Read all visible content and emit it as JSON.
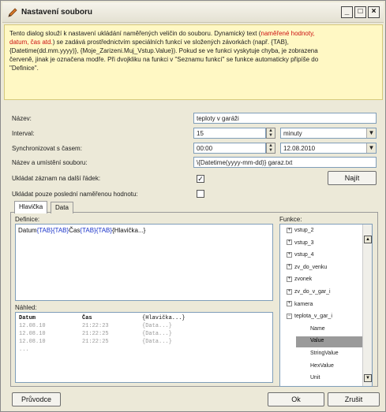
{
  "window": {
    "title": "Nastavení souboru",
    "controls": [
      "_",
      "□",
      "×"
    ]
  },
  "info": {
    "line1": "Tento dialog slouží k nastavení ukládání naměřených veličin do souboru. Dynamický text (",
    "red1": "naměřené hodnoty,",
    "line2_red": "datum, čas atd.",
    "line2": ") se zadává prostřednictvím speciálních funkcí ve složených závorkách (např. {TAB},",
    "line3": "{Datetime(dd.mm.yyyy)}, {Moje_Zarizeni.Muj_Vstup.Value}). Pokud se ve funkci vyskytuje chyba, je zobrazena",
    "line4": "červeně, jinak je označena modře. Při dvojkliku na funkci v \"Seznamu funkcí\" se funkce automaticky připíše do",
    "line5": "\"Definice\"."
  },
  "form": {
    "name_label": "Název:",
    "name_value": "teploty v garáži",
    "interval_label": "Interval:",
    "interval_value": "15",
    "interval_unit": "minuty",
    "sync_label": "Synchronizovat s časem:",
    "sync_time": "00:00",
    "sync_date": "12.08.2010",
    "path_label": "Název a umístění souboru:",
    "path_value": "\\{Datetime(yyyy-mm-dd)} garaz.txt",
    "find_button": "Najít",
    "newline_label": "Ukládat záznam na další řádek:",
    "newline_checked": "✓",
    "lastonly_label": "Ukládat pouze poslední naměřenou hodnotu:",
    "lastonly_checked": ""
  },
  "tabs": [
    "Hlavička",
    "Data"
  ],
  "definition": {
    "label": "Definice:",
    "parts": [
      "Datum",
      "{TAB}{TAB}",
      "Čas",
      "{TAB}{TAB}",
      "{Hlavička...}"
    ]
  },
  "preview": {
    "label": "Náhled:",
    "header": [
      "Datum",
      "Čas",
      "{Hlavička...}"
    ],
    "rows": [
      [
        "12.08.10",
        "21:22:23",
        "{Data...}"
      ],
      [
        "12.08.10",
        "21:22:25",
        "{Data...}"
      ],
      [
        "12.08.10",
        "21:22:25",
        "{Data...}"
      ],
      [
        "...",
        "",
        ""
      ]
    ]
  },
  "functions": {
    "label": "Funkce:",
    "items": [
      {
        "text": "vstup_2",
        "type": "plus"
      },
      {
        "text": "vstup_3",
        "type": "plus"
      },
      {
        "text": "vstup_4",
        "type": "plus"
      },
      {
        "text": "zv_do_venku",
        "type": "plus"
      },
      {
        "text": "zvonek",
        "type": "plus"
      },
      {
        "text": "zv_do_v_gar_i",
        "type": "plus"
      },
      {
        "text": "kamera",
        "type": "plus"
      },
      {
        "text": "teplota_v_gar_i",
        "type": "minus"
      },
      {
        "text": "Name",
        "type": "child"
      },
      {
        "text": "Value",
        "type": "child-selected"
      },
      {
        "text": "StringValue",
        "type": "child"
      },
      {
        "text": "HexValue",
        "type": "child"
      },
      {
        "text": "Unit",
        "type": "child"
      }
    ]
  },
  "buttons": {
    "wizard": "Průvodce",
    "ok": "Ok",
    "cancel": "Zrušit"
  }
}
